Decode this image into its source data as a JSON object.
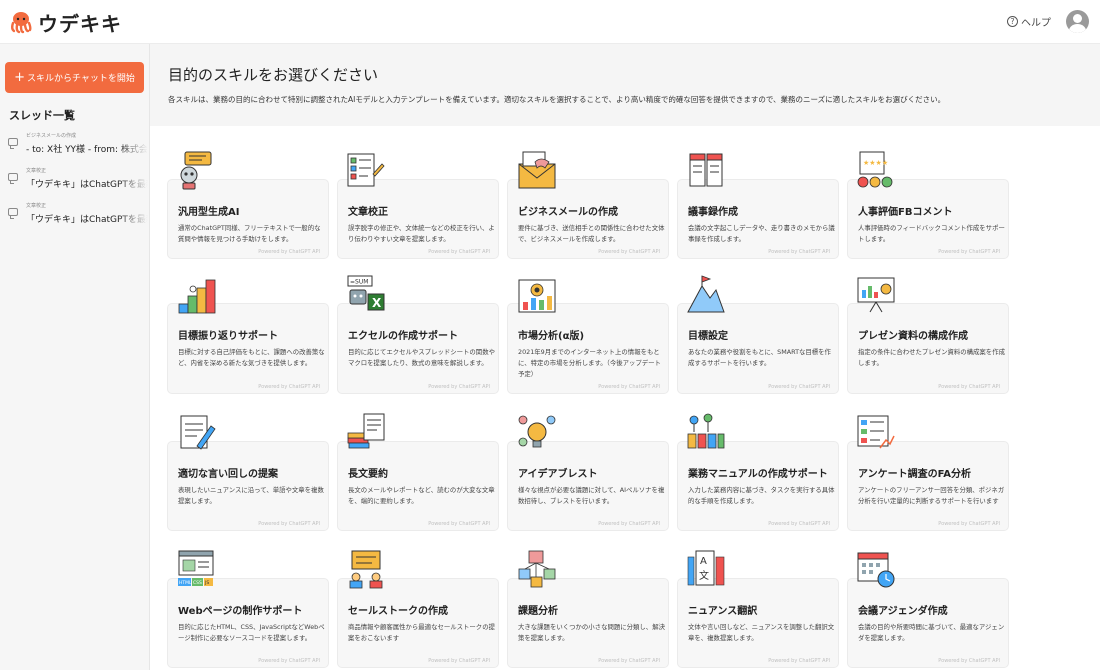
{
  "app": {
    "name": "ウデキキ"
  },
  "header": {
    "help_label": "ヘルプ",
    "help_icon": "?"
  },
  "sidebar": {
    "new_chat_plus": "+",
    "new_chat_label": "スキルからチャットを開始",
    "threads_title": "スレッド一覧",
    "threads": [
      {
        "category": "ビジネスメールの作成",
        "text": "- to: X社 YY様 - from: 株式会社"
      },
      {
        "category": "文章校正",
        "text": "「ウデキキ」はChatGPTを最新"
      },
      {
        "category": "文章校正",
        "text": "「ウデキキ」はChatGPTを最新"
      }
    ]
  },
  "main": {
    "title": "目的のスキルをお選びください",
    "description": "各スキルは、業務の目的に合わせて特別に調整されたAIモデルと入力テンプレートを備えています。適切なスキルを選択することで、より高い精度で的確な回答を提供できますので、業務のニーズに適したスキルをお選びください。"
  },
  "colors": {
    "accent": "#f26b3f",
    "brand_octopus": "#f26b3f"
  },
  "skills": [
    {
      "icon": "robot-icon",
      "title": "汎用型生成AI",
      "desc": "通常のChatGPT同様、フリーテキストで一般的な質問や情報を見つける手助けをします。",
      "powered": "Powered by ChatGPT API"
    },
    {
      "icon": "checklist-icon",
      "title": "文章校正",
      "desc": "誤字脱字の修正や、文体統一などの校正を行い、より伝わりやすい文章を提案します。",
      "powered": "Powered by ChatGPT API"
    },
    {
      "icon": "envelope-handshake-icon",
      "title": "ビジネスメールの作成",
      "desc": "要件に基づき、送信相手との関係性に合わせた文体で、ビジネスメールを作成します。",
      "powered": "Powered by ChatGPT API"
    },
    {
      "icon": "notebook-icon",
      "title": "議事録作成",
      "desc": "会議の文字起こしデータや、走り書きのメモから議事録を作成します。",
      "powered": "Powered by ChatGPT API"
    },
    {
      "icon": "rating-faces-icon",
      "title": "人事評価FBコメント",
      "desc": "人事評価時のフィードバックコメント作成をサポートします。",
      "powered": "Powered by ChatGPT API"
    },
    {
      "icon": "stairs-goal-icon",
      "title": "目標振り返りサポート",
      "desc": "目標に対する自己評価をもとに、課題への改善策など、内省を深める新たな気づきを提供します。",
      "powered": "Powered by ChatGPT API"
    },
    {
      "icon": "excel-robot-icon",
      "title": "エクセルの作成サポート",
      "desc": "目的に応じてエクセルやスプレッドシートの関数やマクロを提案したり、数式の意味を解説します。",
      "powered": "Powered by ChatGPT API"
    },
    {
      "icon": "market-analysis-icon",
      "title": "市場分析(α版)",
      "desc": "2021年9月までのインターネット上の情報をもとに、特定の市場を分析します。（今後アップデート予定）",
      "powered": "Powered by ChatGPT API"
    },
    {
      "icon": "mountain-flag-icon",
      "title": "目標設定",
      "desc": "あなたの業務や役割をもとに、SMARTな目標を作成するサポートを行います。",
      "powered": "Powered by ChatGPT API"
    },
    {
      "icon": "presentation-board-icon",
      "title": "プレゼン資料の構成作成",
      "desc": "指定の条件に合わせたプレゼン資料の構成案を作成します。",
      "powered": "Powered by ChatGPT API"
    },
    {
      "icon": "pen-document-icon",
      "title": "適切な言い回しの提案",
      "desc": "表現したいニュアンスに沿って、単語や文章を複数提案します。",
      "powered": "Powered by ChatGPT API"
    },
    {
      "icon": "books-document-icon",
      "title": "長文要約",
      "desc": "長文のメールやレポートなど、読むのが大変な文章を、端的に要約します。",
      "powered": "Powered by ChatGPT API"
    },
    {
      "icon": "brain-lightbulb-icon",
      "title": "アイデアブレスト",
      "desc": "様々な視点が必要な議題に対して、AIペルソナを複数招待し、ブレストを行います。",
      "powered": "Powered by ChatGPT API"
    },
    {
      "icon": "workflow-icon",
      "title": "業務マニュアルの作成サポート",
      "desc": "入力した業務内容に基づき、タスクを実行する具体的な手順を作成します。",
      "powered": "Powered by ChatGPT API"
    },
    {
      "icon": "survey-form-icon",
      "title": "アンケート調査のFA分析",
      "desc": "アンケートのフリーアンサー回答を分類、ポジネガ分析を行い定量的に判断するサポートを行います",
      "powered": "Powered by ChatGPT API"
    },
    {
      "icon": "web-code-icon",
      "title": "Webページの制作サポート",
      "desc": "目的に応じたHTML、CSS、JavaScriptなどWebページ制作に必要なソースコードを提案します。",
      "powered": "Powered by ChatGPT API"
    },
    {
      "icon": "sales-talk-icon",
      "title": "セールストークの作成",
      "desc": "商品情報や顧客属性から最適なセールストークの提案をおこないます",
      "powered": "Powered by ChatGPT API"
    },
    {
      "icon": "cubes-breakdown-icon",
      "title": "課題分析",
      "desc": "大きな課題をいくつかの小さな問題に分類し、解決策を提案します。",
      "powered": "Powered by ChatGPT API"
    },
    {
      "icon": "translation-icon",
      "title": "ニュアンス翻訳",
      "desc": "文体や言い回しなど、ニュアンスを調整した翻訳文章を、複数提案します。",
      "powered": "Powered by ChatGPT API"
    },
    {
      "icon": "calendar-clock-icon",
      "title": "会議アジェンダ作成",
      "desc": "会議の目的や所要時間に基づいて、最適なアジェンダを提案します。",
      "powered": "Powered by ChatGPT API"
    }
  ],
  "icon_labels": {
    "excel_sum": "=SUM",
    "excel_x": "X",
    "web_html": "HTML",
    "web_css": "CSS",
    "web_js": "JS",
    "translate_a": "A",
    "translate_kanji": "文"
  }
}
